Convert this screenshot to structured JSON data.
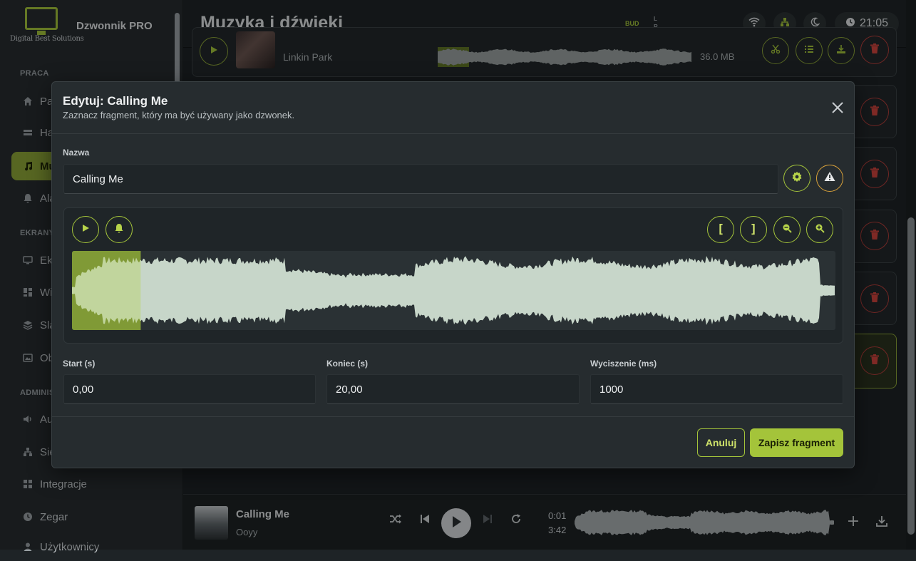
{
  "brand": {
    "name": "Dzwonnik PRO",
    "company": "Digital Best Solutions"
  },
  "sidebar": {
    "sections": [
      {
        "label": "PRACA",
        "items": [
          {
            "label": "Pa",
            "icon": "home-icon"
          },
          {
            "label": "Ha",
            "icon": "schedule-icon"
          },
          {
            "label": "Mu",
            "icon": "music-icon",
            "active": true
          },
          {
            "label": "Ala",
            "icon": "bell-icon"
          }
        ]
      },
      {
        "label": "EKRANY",
        "items": [
          {
            "label": "Ek",
            "icon": "monitor-icon"
          },
          {
            "label": "Wi",
            "icon": "widgets-icon"
          },
          {
            "label": "Sla",
            "icon": "layers-icon"
          },
          {
            "label": "Ob",
            "icon": "image-icon"
          }
        ]
      },
      {
        "label": "ADMINIS",
        "items": [
          {
            "label": "Au",
            "icon": "speaker-icon"
          },
          {
            "label": "Sie",
            "icon": "network-icon"
          },
          {
            "label": "Integracje",
            "icon": "integrations-icon"
          },
          {
            "label": "Zegar",
            "icon": "clock-icon"
          },
          {
            "label": "Użytkownicy",
            "icon": "users-icon"
          }
        ]
      }
    ]
  },
  "header": {
    "title": "Muzyka i dźwięki",
    "badge": "BUD",
    "channel_l": "L",
    "channel_r": "R",
    "time": "21:05"
  },
  "background_track": {
    "artist": "Linkin Park",
    "size": "36.0 MB"
  },
  "modal": {
    "title": "Edytuj: Calling Me",
    "subtitle": "Zaznacz fragment, który ma być używany jako dzwonek.",
    "name_label": "Nazwa",
    "name_value": "Calling Me",
    "start_label": "Start (s)",
    "start_value": "0,00",
    "end_label": "Koniec (s)",
    "end_value": "20,00",
    "fade_label": "Wyciszenie (ms)",
    "fade_value": "1000",
    "bracket_open": "[",
    "bracket_close": "]",
    "selection_fraction": 0.09,
    "cancel_label": "Anuluj",
    "save_label": "Zapisz fragment"
  },
  "player": {
    "title": "Calling Me",
    "artist": "Ooyy",
    "current": "0:01",
    "duration": "3:42"
  },
  "colors": {
    "accent": "#a4c43a",
    "danger": "#d0443e",
    "background": "#1e2326"
  }
}
